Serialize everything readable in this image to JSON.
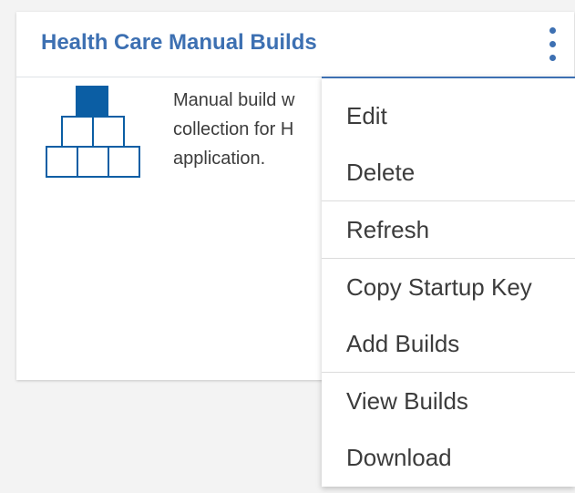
{
  "card": {
    "title": "Health Care Manual Builds",
    "description_lines": [
      "Manual build w",
      "collection for H",
      "application."
    ],
    "overflow_icon": "overflow-menu-vertical-icon",
    "thumbnail_icon": "build-pyramid-icon",
    "accent_color": "#3d70b2",
    "highlight_color": "#0b5ea4"
  },
  "menu": {
    "groups": [
      [
        "Edit",
        "Delete"
      ],
      [
        "Refresh"
      ],
      [
        "Copy Startup Key",
        "Add Builds"
      ],
      [
        "View Builds",
        "Download"
      ]
    ]
  }
}
